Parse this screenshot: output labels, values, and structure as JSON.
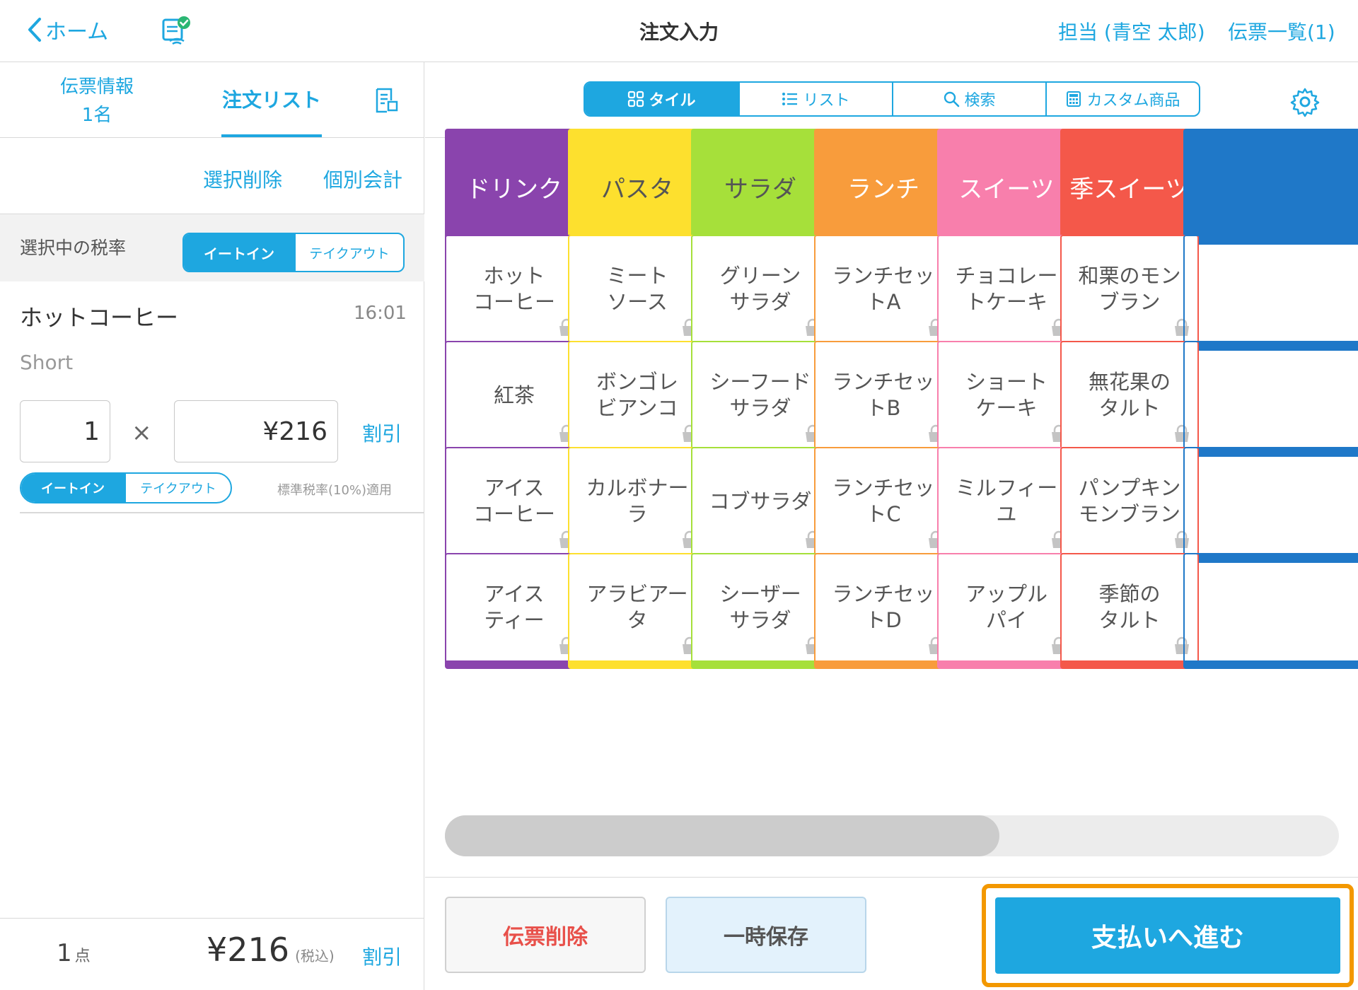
{
  "header": {
    "back_label": "ホーム",
    "title": "注文入力",
    "staff": "担当 (青空 太郎)",
    "slips": "伝票一覧(1)"
  },
  "left": {
    "tab_info_line1": "伝票情報",
    "tab_info_line2": "1名",
    "tab_order": "注文リスト",
    "action_delete_selected": "選択削除",
    "action_split_pay": "個別会計",
    "tax_label": "選択中の税率",
    "tax_options": [
      "イートイン",
      "テイクアウト"
    ],
    "tax_selected": "イートイン",
    "item": {
      "name": "ホットコーヒー",
      "time": "16:01",
      "size": "Short",
      "quantity": "1",
      "times_symbol": "×",
      "price": "¥216",
      "discount": "割引",
      "tax_options": [
        "イートイン",
        "テイクアウト"
      ],
      "tax_note": "標準税率(10%)適用"
    },
    "footer": {
      "count": "1",
      "count_unit": "点",
      "total": "¥216",
      "tax_incl": "(税込)",
      "discount": "割引"
    }
  },
  "right": {
    "view_tabs": [
      "タイル",
      "リスト",
      "検索",
      "カスタム商品"
    ],
    "view_selected": "タイル",
    "categories": [
      {
        "label": "ドリンク",
        "color": "#8a44ad"
      },
      {
        "label": "パスタ",
        "color": "#fde02e"
      },
      {
        "label": "サラダ",
        "color": "#a6e03a"
      },
      {
        "label": "ランチ",
        "color": "#f89c3c"
      },
      {
        "label": "スイーツ",
        "color": "#f87fac"
      },
      {
        "label": "季スイーツ",
        "color": "#f4584a"
      }
    ],
    "partial_category_color": "#1f78c8",
    "products": [
      [
        "ホット\nコーヒー",
        "ミート\nソース",
        "グリーン\nサラダ",
        "ランチセッ\nトA",
        "チョコレー\nトケーキ",
        "和栗のモン\nブラン"
      ],
      [
        "紅茶",
        "ボンゴレ\nビアンコ",
        "シーフード\nサラダ",
        "ランチセッ\nトB",
        "ショート\nケーキ",
        "無花果の\nタルト"
      ],
      [
        "アイス\nコーヒー",
        "カルボナー\nラ",
        "コブサラダ",
        "ランチセッ\nトC",
        "ミルフィー\nユ",
        "パンプキン\nモンブラン"
      ],
      [
        "アイス\nティー",
        "アラビアー\nタ",
        "シーザー\nサラダ",
        "ランチセッ\nトD",
        "アップル\nパイ",
        "季節の\nタルト"
      ]
    ],
    "scroll_fraction": 0.62,
    "buttons": {
      "delete_slip": "伝票削除",
      "hold": "一時保存",
      "pay": "支払いへ進む"
    },
    "highlight_color": "#f39800"
  }
}
